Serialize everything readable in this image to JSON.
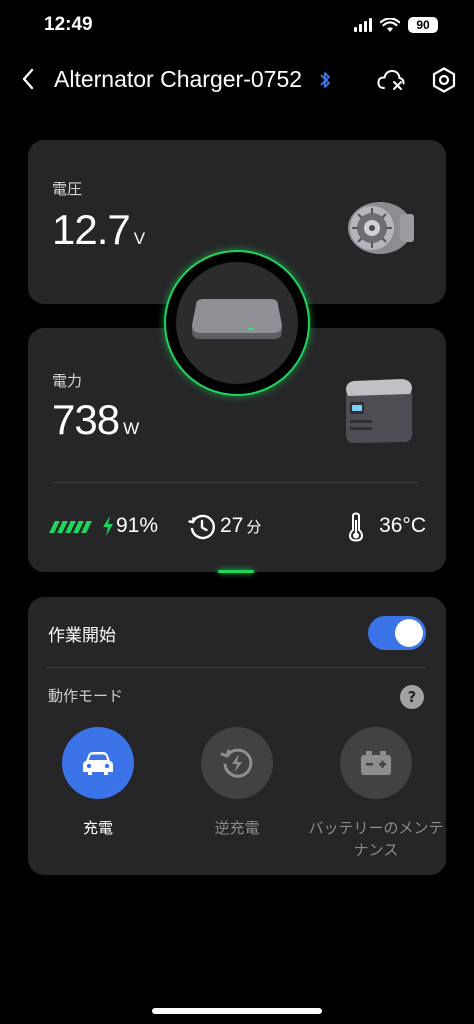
{
  "status_bar": {
    "time": "12:49",
    "battery": "90"
  },
  "header": {
    "title": "Alternator Charger-0752"
  },
  "voltage": {
    "label": "電圧",
    "value": "12.7",
    "unit": "V"
  },
  "power": {
    "label": "電力",
    "value": "738",
    "unit": "W"
  },
  "stats": {
    "battery_percent": "91%",
    "time_value": "27",
    "time_unit": "分",
    "temperature": "36°C"
  },
  "operation": {
    "start_label": "作業開始",
    "toggle_on": true
  },
  "mode": {
    "title": "動作モード",
    "help": "?",
    "options": [
      {
        "label": "充電",
        "icon": "car-icon",
        "selected": true
      },
      {
        "label": "逆充電",
        "icon": "reverse-charge-icon",
        "selected": false
      },
      {
        "label": "バッテリーのメンテナンス",
        "icon": "battery-maintenance-icon",
        "selected": false
      }
    ]
  },
  "colors": {
    "accent_blue": "#3a74e8",
    "status_green": "#1fd65c",
    "card_bg": "#262628"
  }
}
